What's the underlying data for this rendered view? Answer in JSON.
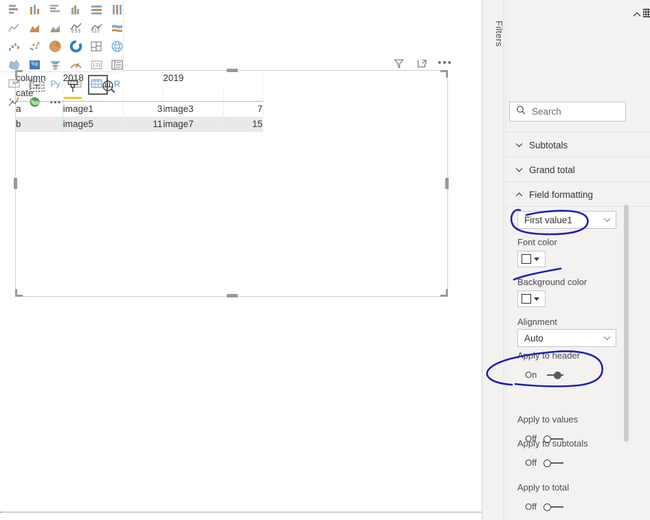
{
  "filters_pane": {
    "label": "Filters"
  },
  "visualizations": {
    "gallery_icons": [
      "stacked-bar-chart-icon",
      "stacked-column-chart-icon",
      "clustered-bar-chart-icon",
      "clustered-column-chart-icon",
      "100-stacked-bar-chart-icon",
      "100-stacked-column-chart-icon",
      "line-chart-icon",
      "area-chart-icon",
      "stacked-area-chart-icon",
      "line-stacked-column-chart-icon",
      "line-clustered-column-chart-icon",
      "ribbon-chart-icon",
      "waterfall-chart-icon",
      "scatter-chart-icon",
      "pie-chart-icon",
      "donut-chart-icon",
      "treemap-icon",
      "map-icon",
      "filled-map-icon",
      "shape-map-icon",
      "funnel-icon",
      "gauge-icon",
      "card-icon",
      "multi-row-card-icon",
      "kpi-icon",
      "slicer-icon",
      "python-visual-icon",
      "table-icon",
      "matrix-icon",
      "r-script-visual-icon",
      "key-influencers-icon",
      "arcgis-map-icon",
      "more-visuals-icon"
    ],
    "selected_visual": "matrix-icon",
    "collapse_icon": "chevron-up-icon",
    "tabs": [
      {
        "name": "fields-tab",
        "icon": "fields-table-icon",
        "active": false
      },
      {
        "name": "format-tab",
        "icon": "paint-roller-icon",
        "active": true
      },
      {
        "name": "analytics-tab",
        "icon": "analytics-magnifier-icon",
        "active": false
      }
    ],
    "search": {
      "placeholder": "Search",
      "value": "",
      "icon": "search-icon"
    }
  },
  "format_sections": [
    {
      "label": "Subtotals",
      "expanded": false,
      "chevron": "chevron-down-icon"
    },
    {
      "label": "Grand total",
      "expanded": false,
      "chevron": "chevron-down-icon"
    },
    {
      "label": "Field formatting",
      "expanded": true,
      "chevron": "chevron-up-icon"
    }
  ],
  "field_formatting": {
    "field_select": {
      "value": "First value1",
      "chevron": "chevron-down-icon"
    },
    "font_color": {
      "label": "Font color",
      "swatch": "#ffffff",
      "caret": "caret-down-icon"
    },
    "background_color": {
      "label": "Background color",
      "swatch": "#ffffff",
      "caret": "caret-down-icon"
    },
    "alignment": {
      "label": "Alignment",
      "value": "Auto",
      "chevron": "chevron-down-icon"
    },
    "toggles": [
      {
        "label": "Apply to header",
        "state": "On"
      },
      {
        "label": "Apply to values",
        "state": "Off"
      },
      {
        "label": "Apply to subtotals",
        "state": "Off"
      },
      {
        "label": "Apply to total",
        "state": "Off"
      }
    ]
  },
  "visual": {
    "toolbar": [
      {
        "name": "filter-icon",
        "label": "Filters"
      },
      {
        "name": "focus-mode-icon",
        "label": "Focus mode"
      },
      {
        "name": "more-options-icon",
        "label": "More options"
      }
    ],
    "matrix": {
      "row_header_label_line1": "column",
      "row_header_label_line2": "cate",
      "column_headers": [
        "2018",
        "2019"
      ],
      "rows": [
        {
          "row_header": "a",
          "cells": [
            "image1",
            "3",
            "image3",
            "7"
          ]
        },
        {
          "row_header": "b",
          "cells": [
            "image5",
            "11",
            "image7",
            "15"
          ]
        }
      ],
      "header_rule_color": "#8ecbe0",
      "alt_row_color": "#e9e9e9"
    }
  },
  "annotations": {
    "pen_color": "#1f1fb4",
    "marks": [
      "ellipse-around-field-select",
      "stroke-above-background-color",
      "ellipse-around-apply-to-header"
    ]
  }
}
